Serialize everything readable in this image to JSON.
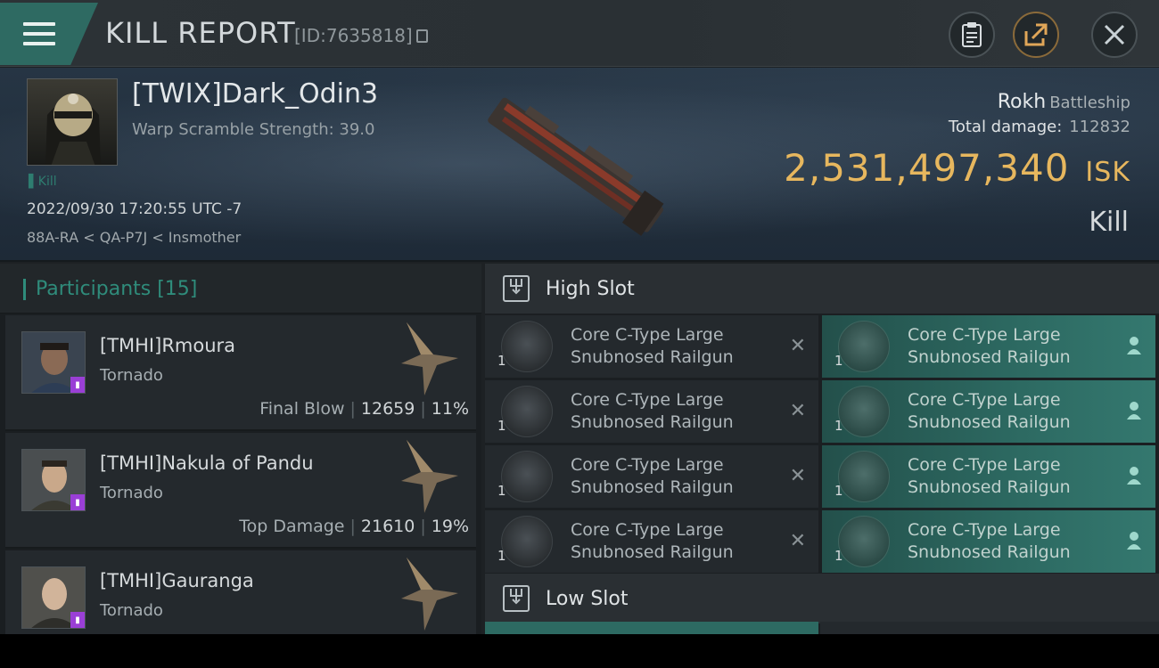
{
  "header": {
    "title": "KILL REPORT",
    "id_text": "[ID:7635818]",
    "icons": [
      "menu-icon",
      "clipboard-icon",
      "share-icon",
      "close-icon"
    ]
  },
  "victim": {
    "name": "[TWIX]Dark_Odin3",
    "warp_scramble": "Warp Scramble Strength: 39.0",
    "kill_tag": "Kill",
    "datetime": "2022/09/30 17:20:55 UTC -7",
    "location": "88A-RA < QA-P7J < Insmother",
    "ship_name": "Rokh",
    "ship_class": "Battleship",
    "total_damage_label": "Total damage:",
    "total_damage": "112832",
    "isk_value": "2,531,497,340",
    "isk_unit": "ISK",
    "result": "Kill"
  },
  "participants": {
    "header": "Participants [15]",
    "items": [
      {
        "name": "[TMHI]Rmoura",
        "ship": "Tornado",
        "label": "Final Blow",
        "damage": "12659",
        "percent": "11%"
      },
      {
        "name": "[TMHI]Nakula of Pandu",
        "ship": "Tornado",
        "label": "Top Damage",
        "damage": "21610",
        "percent": "19%"
      },
      {
        "name": "[TMHI]Gauranga",
        "ship": "Tornado",
        "label": "",
        "damage": "",
        "percent": ""
      }
    ]
  },
  "slots": {
    "high_label": "High Slot",
    "low_label": "Low Slot",
    "high_modules": [
      {
        "line1": "Core C-Type Large",
        "line2": "Snubnosed Railgun",
        "qty": "1",
        "state": "destroyed"
      },
      {
        "line1": "Core C-Type Large",
        "line2": "Snubnosed Railgun",
        "qty": "1",
        "state": "dropped"
      },
      {
        "line1": "Core C-Type Large",
        "line2": "Snubnosed Railgun",
        "qty": "1",
        "state": "destroyed"
      },
      {
        "line1": "Core C-Type Large",
        "line2": "Snubnosed Railgun",
        "qty": "1",
        "state": "dropped"
      },
      {
        "line1": "Core C-Type Large",
        "line2": "Snubnosed Railgun",
        "qty": "1",
        "state": "destroyed"
      },
      {
        "line1": "Core C-Type Large",
        "line2": "Snubnosed Railgun",
        "qty": "1",
        "state": "dropped"
      },
      {
        "line1": "Core C-Type Large",
        "line2": "Snubnosed Railgun",
        "qty": "1",
        "state": "destroyed"
      },
      {
        "line1": "Core C-Type Large",
        "line2": "Snubnosed Railgun",
        "qty": "1",
        "state": "dropped"
      }
    ]
  },
  "colors": {
    "accent_teal": "#2f8c7b",
    "isk_gold": "#e7b75e",
    "badge_purple": "#9a3fd6"
  }
}
